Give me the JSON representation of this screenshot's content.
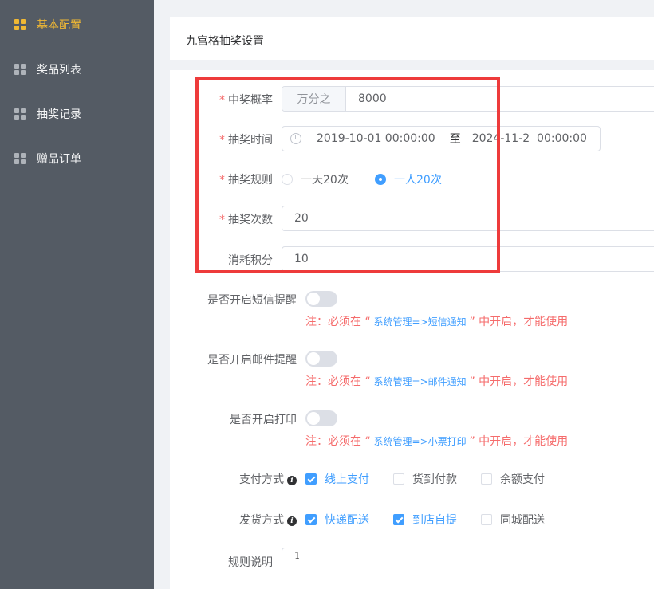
{
  "sidebar": {
    "items": [
      {
        "label": "基本配置",
        "icon": "grid-icon",
        "active": true
      },
      {
        "label": "奖品列表",
        "icon": "grid-icon",
        "active": false
      },
      {
        "label": "抽奖记录",
        "icon": "grid-icon",
        "active": false
      },
      {
        "label": "赠品订单",
        "icon": "grid-icon",
        "active": false
      }
    ]
  },
  "header": {
    "title": "九宫格抽奖设置"
  },
  "form": {
    "rate": {
      "label": "中奖概率",
      "prepend": "万分之",
      "value": "8000"
    },
    "time": {
      "label": "抽奖时间",
      "start": "2019-10-01 00:00:00",
      "separator": "至",
      "end": "2024-11-2  00:00:00"
    },
    "rule": {
      "label": "抽奖规则",
      "options": [
        "一天20次",
        "一人20次"
      ],
      "selected": "一人20次"
    },
    "count": {
      "label": "抽奖次数",
      "value": "20"
    },
    "points": {
      "label": "消耗积分",
      "value": "10"
    },
    "sms": {
      "label": "是否开启短信提醒",
      "enabled": false,
      "note_prefix": "注：必须在 “",
      "note_path": " 系统管理=>短信通知 ",
      "note_suffix": "” 中开启，才能使用"
    },
    "email": {
      "label": "是否开启邮件提醒",
      "enabled": false,
      "note_prefix": "注：必须在 “",
      "note_path": " 系统管理=>邮件通知 ",
      "note_suffix": "” 中开启，才能使用"
    },
    "print": {
      "label": "是否开启打印",
      "enabled": false,
      "note_prefix": "注：必须在 “",
      "note_path": " 系统管理=>小票打印 ",
      "note_suffix": "” 中开启，才能使用"
    },
    "payment": {
      "label": "支付方式",
      "options": [
        {
          "label": "线上支付",
          "checked": true
        },
        {
          "label": "货到付款",
          "checked": false
        },
        {
          "label": "余额支付",
          "checked": false
        }
      ]
    },
    "delivery": {
      "label": "发货方式",
      "options": [
        {
          "label": "快递配送",
          "checked": true
        },
        {
          "label": "到店自提",
          "checked": true
        },
        {
          "label": "同城配送",
          "checked": false
        }
      ]
    },
    "rules_desc": {
      "label": "规则说明",
      "value": "1"
    }
  },
  "colors": {
    "accent": "#409eff",
    "active_sidebar": "#f0b834",
    "warning": "#f56c6c",
    "highlight_frame": "#ee3b3b"
  }
}
